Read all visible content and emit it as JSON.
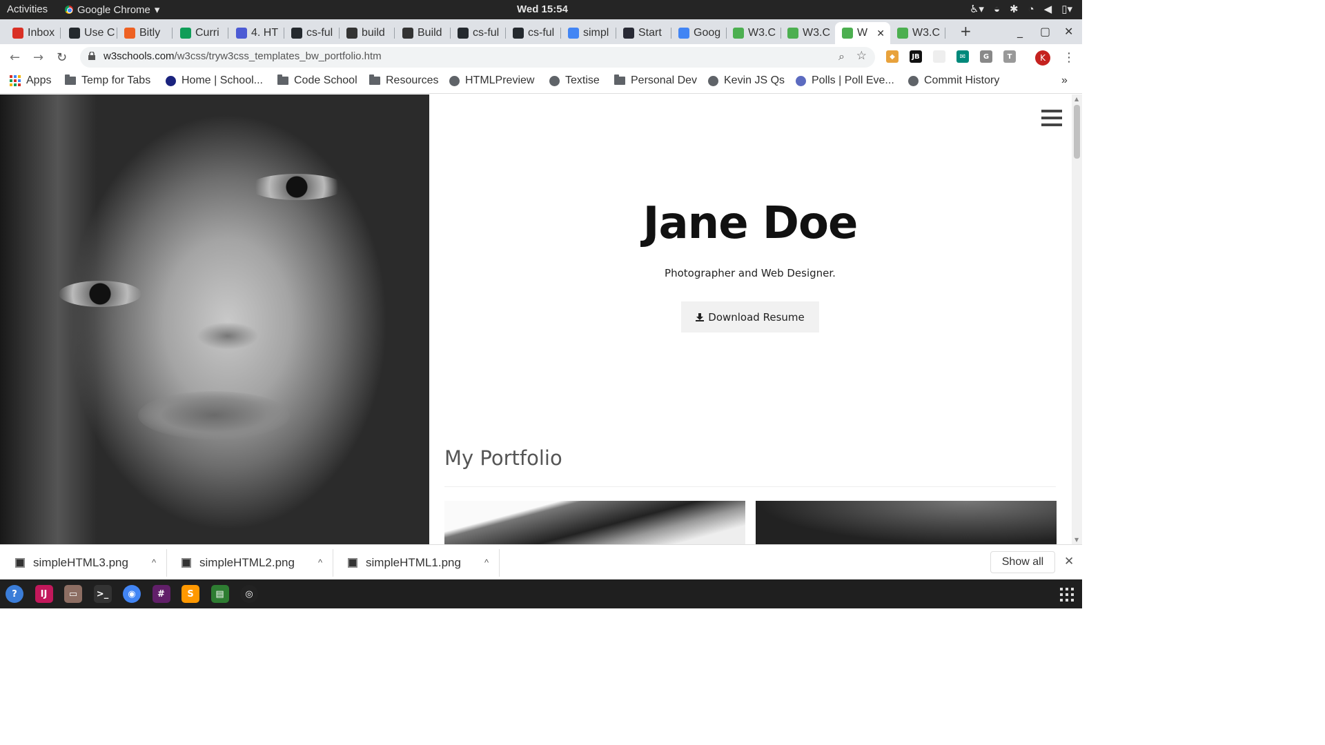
{
  "system_bar": {
    "activities": "Activities",
    "app_name": "Google Chrome",
    "clock": "Wed 15:54"
  },
  "tabs": [
    {
      "label": "Inbox",
      "favicon": "gmail-icon",
      "color": "#d93025"
    },
    {
      "label": "Use C",
      "favicon": "github-icon",
      "color": "#24292e"
    },
    {
      "label": "Bitly",
      "favicon": "bitly-icon",
      "color": "#ee6123"
    },
    {
      "label": "Curri",
      "favicon": "drive-icon",
      "color": "#0f9d58"
    },
    {
      "label": "4. HT",
      "favicon": "docs-icon",
      "color": "#4c5bd4"
    },
    {
      "label": "cs-ful",
      "favicon": "github-icon",
      "color": "#24292e"
    },
    {
      "label": "build",
      "favicon": "code-icon",
      "color": "#333"
    },
    {
      "label": "Build",
      "favicon": "code-icon",
      "color": "#333"
    },
    {
      "label": "cs-ful",
      "favicon": "github-icon",
      "color": "#24292e"
    },
    {
      "label": "cs-ful",
      "favicon": "github-icon",
      "color": "#24292e"
    },
    {
      "label": "simpl",
      "favicon": "google-icon",
      "color": "#4285f4"
    },
    {
      "label": "Start",
      "favicon": "w3schools-icon",
      "color": "#282a35"
    },
    {
      "label": "Goog",
      "favicon": "google-icon",
      "color": "#4285f4"
    },
    {
      "label": "W3.C",
      "favicon": "w3css-icon",
      "color": "#4caf50"
    },
    {
      "label": "W3.C",
      "favicon": "w3css-icon",
      "color": "#4caf50"
    },
    {
      "label": "W",
      "favicon": "w3css-icon",
      "color": "#4caf50"
    },
    {
      "label": "W3.C",
      "favicon": "w3css-icon",
      "color": "#4caf50"
    }
  ],
  "address_bar": {
    "domain": "w3schools.com",
    "path": "/w3css/tryw3css_templates_bw_portfolio.htm"
  },
  "profile_initial": "K",
  "bookmarks": [
    {
      "label": "Apps",
      "icon": "apps-grid-icon"
    },
    {
      "label": "Temp for Tabs",
      "icon": "folder-icon"
    },
    {
      "label": "Home | School...",
      "icon": "school-icon"
    },
    {
      "label": "Code School",
      "icon": "folder-icon"
    },
    {
      "label": "Resources",
      "icon": "folder-icon"
    },
    {
      "label": "HTMLPreview",
      "icon": "globe-icon"
    },
    {
      "label": "Textise",
      "icon": "globe-icon"
    },
    {
      "label": "Personal Dev",
      "icon": "folder-icon"
    },
    {
      "label": "Kevin JS Qs",
      "icon": "globe-icon"
    },
    {
      "label": "Polls | Poll Eve...",
      "icon": "polls-icon"
    },
    {
      "label": "Commit History",
      "icon": "globe-icon"
    }
  ],
  "bookmarks_overflow": "»",
  "page": {
    "name": "Jane Doe",
    "tagline": "Photographer and Web Designer.",
    "download_button": "Download Resume",
    "section_title": "My Portfolio"
  },
  "downloads": {
    "items": [
      "simpleHTML3.png",
      "simpleHTML2.png",
      "simpleHTML1.png"
    ],
    "show_all": "Show all"
  },
  "dock": [
    {
      "name": "help-icon",
      "color": "#3b7dd8",
      "glyph": "?"
    },
    {
      "name": "intellij-icon",
      "color": "#c2185b",
      "glyph": "IJ"
    },
    {
      "name": "files-icon",
      "color": "#8d6e63",
      "glyph": "▭"
    },
    {
      "name": "terminal-icon",
      "color": "#333333",
      "glyph": ">_"
    },
    {
      "name": "chrome-icon",
      "color": "#4285f4",
      "glyph": "◉"
    },
    {
      "name": "slack-icon",
      "color": "#611f69",
      "glyph": "#"
    },
    {
      "name": "sublime-icon",
      "color": "#ff9800",
      "glyph": "S"
    },
    {
      "name": "monitor-icon",
      "color": "#2e7d32",
      "glyph": "▤"
    },
    {
      "name": "obs-icon",
      "color": "#222222",
      "glyph": "◎"
    }
  ]
}
